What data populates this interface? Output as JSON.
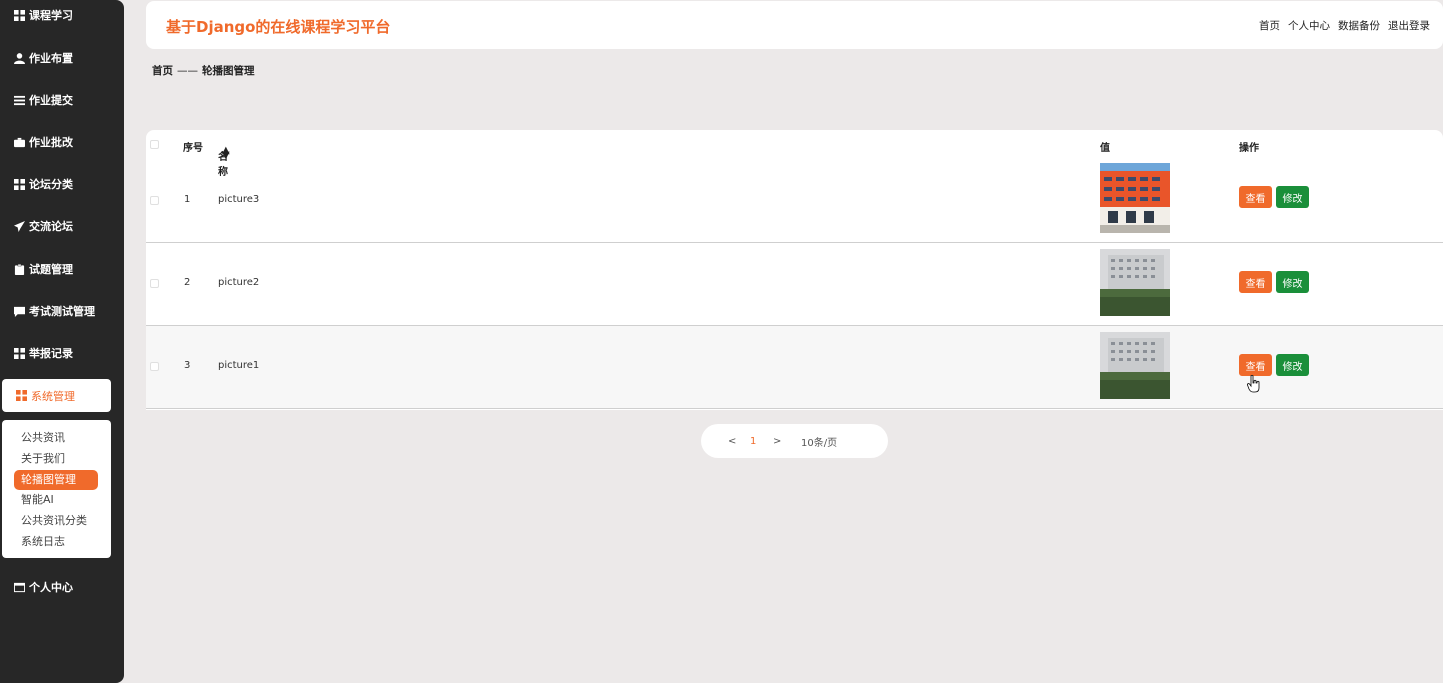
{
  "app": {
    "title": "基于Django的在线课程学习平台"
  },
  "header_nav": [
    "首页",
    "个人中心",
    "数据备份",
    "退出登录"
  ],
  "sidebar": {
    "items": [
      {
        "label": "课程学习",
        "icon": "grid-icon"
      },
      {
        "label": "作业布置",
        "icon": "user-icon"
      },
      {
        "label": "作业提交",
        "icon": "list-icon"
      },
      {
        "label": "作业批改",
        "icon": "briefcase-icon"
      },
      {
        "label": "论坛分类",
        "icon": "grid-icon"
      },
      {
        "label": "交流论坛",
        "icon": "send-icon"
      },
      {
        "label": "试题管理",
        "icon": "clipboard-icon"
      },
      {
        "label": "考试测试管理",
        "icon": "comment-icon"
      },
      {
        "label": "举报记录",
        "icon": "grid-icon"
      },
      {
        "label": "系统管理",
        "icon": "grid-icon",
        "active": true
      }
    ],
    "submenu": [
      "公共资讯",
      "关于我们",
      "轮播图管理",
      "智能AI",
      "公共资讯分类",
      "系统日志"
    ],
    "submenu_active": "轮播图管理",
    "personal": {
      "label": "个人中心",
      "icon": "calendar-icon"
    }
  },
  "breadcrumb": {
    "home": "首页",
    "separator": "——",
    "current": "轮播图管理"
  },
  "table": {
    "headers": {
      "index": "序号",
      "name": "名称",
      "value": "值",
      "actions": "操作"
    },
    "rows": [
      {
        "index": "1",
        "name": "picture3",
        "image": "orange-building"
      },
      {
        "index": "2",
        "name": "picture2",
        "image": "gray-building"
      },
      {
        "index": "3",
        "name": "picture1",
        "image": "gray-building"
      }
    ],
    "view_label": "查看",
    "edit_label": "修改"
  },
  "pagination": {
    "prev": "<",
    "current": "1",
    "next": ">",
    "page_size": "10条/页"
  },
  "colors": {
    "accent": "#f06a2b",
    "edit": "#1a8f3a",
    "sidebar": "#272727",
    "background": "#ece9e9"
  }
}
